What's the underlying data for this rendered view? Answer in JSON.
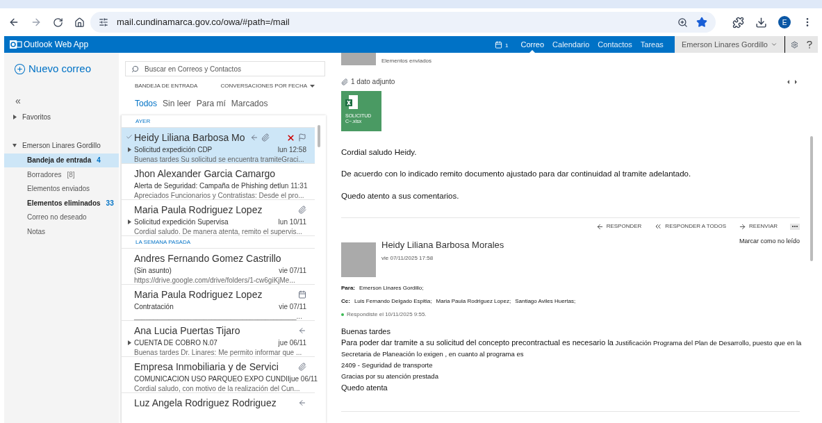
{
  "browser": {
    "url": "mail.cundinamarca.gov.co/owa/#path=/mail",
    "profile_initial": "E"
  },
  "app": {
    "title": "Outlook Web App",
    "calendar_count": "1",
    "nav": [
      {
        "label": "Correo",
        "selected": true
      },
      {
        "label": "Calendario",
        "selected": false
      },
      {
        "label": "Contactos",
        "selected": false
      },
      {
        "label": "Tareas",
        "selected": false
      }
    ],
    "user": "Emerson Linares Gordillo"
  },
  "sidebar": {
    "new_mail": "Nuevo correo",
    "collapse": "«",
    "favorites": "Favoritos",
    "account": "Emerson Linares Gordillo",
    "folders": [
      {
        "name": "Bandeja de entrada",
        "count": "4",
        "unread": true,
        "selected": true
      },
      {
        "name": "Borradores",
        "count": "[8]",
        "unread": false,
        "selected": false
      },
      {
        "name": "Elementos enviados",
        "unread": false,
        "selected": false
      },
      {
        "name": "Elementos eliminados",
        "count": "33",
        "unread": true,
        "selected": false
      },
      {
        "name": "Correo no deseado",
        "unread": false,
        "selected": false
      },
      {
        "name": "Notas",
        "unread": false,
        "selected": false
      }
    ]
  },
  "list": {
    "search_placeholder": "Buscar en Correos y Contactos",
    "folder_label": "BANDEJA DE ENTRADA",
    "sort_label": "CONVERSACIONES POR FECHA",
    "filters": [
      {
        "label": "Todos",
        "selected": true
      },
      {
        "label": "Sin leer",
        "selected": false
      },
      {
        "label": "Para mí",
        "selected": false
      },
      {
        "label": "Marcados",
        "selected": false
      }
    ],
    "groups": [
      {
        "title": "AYER",
        "messages": [
          {
            "sender": "Heidy Liliana Barbosa Mo",
            "subject": "Solicitud expedición CDP",
            "date": "lun 12:58",
            "preview": "Buenas tardes Su solicitud se encuentra tramiteGraci...",
            "thread": true,
            "selected": true,
            "checked": true,
            "replied": true,
            "attachment": true,
            "meeting": false
          },
          {
            "sender": "Jhon Alexander Garcia Camargo",
            "subject": "Alerta de Seguridad: Campaña de Phishing det",
            "date": "lun 11:31",
            "preview": "Apreciados Funcionarios y Contratistas: Desde el pro...",
            "thread": false,
            "selected": false,
            "checked": false,
            "replied": false,
            "attachment": false,
            "meeting": false
          },
          {
            "sender": "Maria Paula Rodriguez Lopez",
            "subject": "Solicitud expedición Supervisa",
            "date": "lun 10/11",
            "preview": "Cordial saludo. De manera atenta, remito el supervis...",
            "thread": true,
            "selected": false,
            "checked": false,
            "replied": false,
            "attachment": true,
            "meeting": false
          }
        ]
      },
      {
        "title": "LA SEMANA PASADA",
        "messages": [
          {
            "sender": "Andres Fernando Gomez Castrillo",
            "subject": "(Sin asunto)",
            "date": "vie 07/11",
            "preview": "https://drive.google.com/drive/folders/1-cw6giKjMe...",
            "thread": false,
            "selected": false,
            "checked": false,
            "replied": false,
            "attachment": false,
            "meeting": false
          },
          {
            "sender": "Maria Paula Rodriguez Lopez",
            "subject": "Contratación",
            "date": "vie 07/11",
            "preview": "__________________________________________...",
            "thread": false,
            "selected": false,
            "checked": false,
            "replied": false,
            "attachment": false,
            "meeting": true
          },
          {
            "sender": "Ana Lucia Puertas Tijaro",
            "subject": "CUENTA DE COBRO N.07",
            "date": "jue 06/11",
            "preview": "Buenas tardes Dr. Linares: Me permito informar que ...",
            "thread": true,
            "selected": false,
            "checked": false,
            "replied": true,
            "attachment": false,
            "meeting": false
          },
          {
            "sender": "Empresa Inmobiliaria y de Servici",
            "subject": "COMUNICACION USO PARQUEO EXPO CUNDII",
            "date": "jue 06/11",
            "preview": "Cordial saludo, con motivo de la realización del Cun...",
            "thread": false,
            "selected": false,
            "checked": false,
            "replied": false,
            "attachment": true,
            "meeting": false
          },
          {
            "sender": "Luz Angela Rodriguez Rodriguez",
            "thread": false,
            "selected": false,
            "checked": false,
            "replied": true,
            "attachment": false,
            "meeting": false
          }
        ]
      }
    ]
  },
  "reading": {
    "prev_folder": "Elementos enviados",
    "attachments_label": "1 dato adjunto",
    "attachment": {
      "name": "SOLICITUD C~.xlsx"
    },
    "prev_body": [
      "Cordial saludo Heidy.",
      "De acuerdo con lo indicado remito documento ajustado para dar  continuidad al tramite adelantado.",
      "Quedo atento a sus comentarios."
    ],
    "actions": [
      "RESPONDER",
      "RESPONDER A TODOS",
      "REENVIAR"
    ],
    "message": {
      "sender": "Heidy Liliana Barbosa Morales",
      "date": "vie 07/11/2025 17:58",
      "mark_unread": "Marcar como no leído",
      "to_label": "Para:",
      "to": [
        "Emerson Linares Gordillo;"
      ],
      "cc_label": "Cc:",
      "cc": [
        "Luis Fernando Delgado Espitia;",
        "Maria Paula Rodriguez Lopez;",
        "Santiago Aviles Huertas;"
      ],
      "replied": "Respondiste el 10/11/2025 9:55.",
      "body": [
        {
          "kind": "large",
          "text": "Buenas tardes"
        },
        {
          "kind": "mixed",
          "text": "Para poder dar tramite a su solicitud del concepto precontractual  es necesario la",
          "small": "Justificación Programa del Plan de Desarrollo, puesto que en la Secretaria de Planeación lo exigen , en cuanto al programa es"
        },
        {
          "kind": "small",
          "text": "2409 - Seguridad de transporte"
        },
        {
          "kind": "small",
          "text": "Gracias por su atención prestada"
        },
        {
          "kind": "large",
          "text": "Quedo atenta"
        }
      ]
    }
  }
}
